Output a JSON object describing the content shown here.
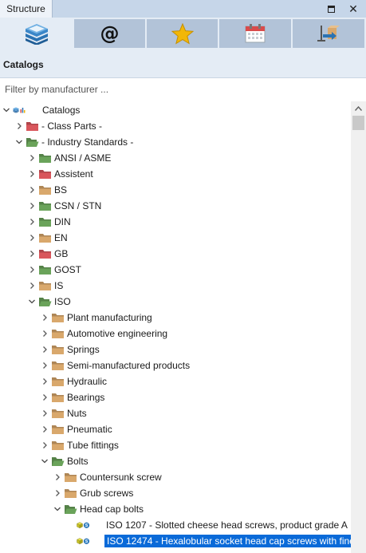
{
  "panel": {
    "tab_label": "Structure"
  },
  "toolbar": {
    "buttons": [
      {
        "icon": "catalog-books-icon",
        "active": true
      },
      {
        "icon": "at-sign-icon",
        "glyph": "@"
      },
      {
        "icon": "star-icon"
      },
      {
        "icon": "calendar-icon"
      },
      {
        "icon": "export-arrow-icon"
      }
    ]
  },
  "section": {
    "title": "Catalogs"
  },
  "filter": {
    "placeholder": "Filter by manufacturer ...",
    "value": ""
  },
  "colors": {
    "folder_green": "#6aa35a",
    "folder_red": "#d9565c",
    "folder_tan": "#d9a86c",
    "selection": "#0a6ad8"
  },
  "tree": [
    {
      "label": "Catalogs",
      "level": 0,
      "state": "expanded",
      "icon": "root"
    },
    {
      "label": "- Class Parts -",
      "level": 1,
      "state": "collapsed",
      "icon": "red"
    },
    {
      "label": "- Industry Standards -",
      "level": 1,
      "state": "expanded",
      "icon": "green-open"
    },
    {
      "label": "ANSI / ASME",
      "level": 2,
      "state": "collapsed",
      "icon": "green"
    },
    {
      "label": "Assistent",
      "level": 2,
      "state": "collapsed",
      "icon": "red"
    },
    {
      "label": "BS",
      "level": 2,
      "state": "collapsed",
      "icon": "tan"
    },
    {
      "label": "CSN / STN",
      "level": 2,
      "state": "collapsed",
      "icon": "green"
    },
    {
      "label": "DIN",
      "level": 2,
      "state": "collapsed",
      "icon": "green"
    },
    {
      "label": "EN",
      "level": 2,
      "state": "collapsed",
      "icon": "tan"
    },
    {
      "label": "GB",
      "level": 2,
      "state": "collapsed",
      "icon": "red"
    },
    {
      "label": "GOST",
      "level": 2,
      "state": "collapsed",
      "icon": "green"
    },
    {
      "label": "IS",
      "level": 2,
      "state": "collapsed",
      "icon": "tan"
    },
    {
      "label": "ISO",
      "level": 2,
      "state": "expanded",
      "icon": "green-open"
    },
    {
      "label": "Plant manufacturing",
      "level": 3,
      "state": "collapsed",
      "icon": "tan"
    },
    {
      "label": "Automotive engineering",
      "level": 3,
      "state": "collapsed",
      "icon": "tan"
    },
    {
      "label": "Springs",
      "level": 3,
      "state": "collapsed",
      "icon": "tan"
    },
    {
      "label": "Semi-manufactured products",
      "level": 3,
      "state": "collapsed",
      "icon": "tan"
    },
    {
      "label": "Hydraulic",
      "level": 3,
      "state": "collapsed",
      "icon": "tan"
    },
    {
      "label": "Bearings",
      "level": 3,
      "state": "collapsed",
      "icon": "tan"
    },
    {
      "label": "Nuts",
      "level": 3,
      "state": "collapsed",
      "icon": "tan"
    },
    {
      "label": "Pneumatic",
      "level": 3,
      "state": "collapsed",
      "icon": "tan"
    },
    {
      "label": "Tube fittings",
      "level": 3,
      "state": "collapsed",
      "icon": "tan"
    },
    {
      "label": "Bolts",
      "level": 3,
      "state": "expanded",
      "icon": "green-open"
    },
    {
      "label": "Countersunk screw",
      "level": 4,
      "state": "collapsed",
      "icon": "tan"
    },
    {
      "label": "Grub screws",
      "level": 4,
      "state": "collapsed",
      "icon": "tan"
    },
    {
      "label": "Head cap bolts",
      "level": 4,
      "state": "expanded",
      "icon": "green-open"
    },
    {
      "label": "ISO 1207 - Slotted cheese head screws, product grade A",
      "level": 5,
      "state": "leaf",
      "icon": "part"
    },
    {
      "label": "ISO 12474 - Hexalobular socket head cap screws with fine",
      "level": 5,
      "state": "leaf",
      "icon": "part",
      "selected": true
    }
  ]
}
